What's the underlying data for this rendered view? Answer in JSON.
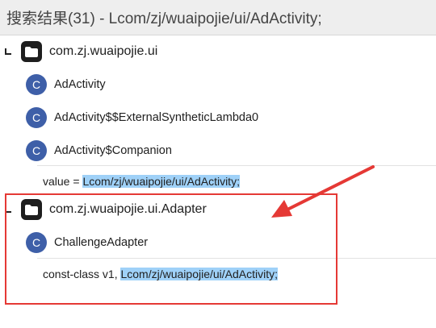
{
  "header": {
    "title": "搜索结果(31) - Lcom/zj/wuaipojie/ui/AdActivity;"
  },
  "groups": [
    {
      "package": "com.zj.wuaipojie.ui",
      "classes": [
        "AdActivity",
        "AdActivity$$ExternalSyntheticLambda0",
        "AdActivity$Companion"
      ],
      "result": {
        "prefix": "value = ",
        "match": "Lcom/zj/wuaipojie/ui/AdActivity;"
      }
    },
    {
      "package": "com.zj.wuaipojie.ui.Adapter",
      "classes": [
        "ChallengeAdapter"
      ],
      "result": {
        "prefix": "const-class v1, ",
        "match": "Lcom/zj/wuaipojie/ui/AdActivity;"
      }
    }
  ],
  "badges": {
    "class_letter": "C"
  },
  "colors": {
    "highlight": "#9fd1f8",
    "annotation": "#e53935",
    "class_badge": "#3e5fa8"
  }
}
